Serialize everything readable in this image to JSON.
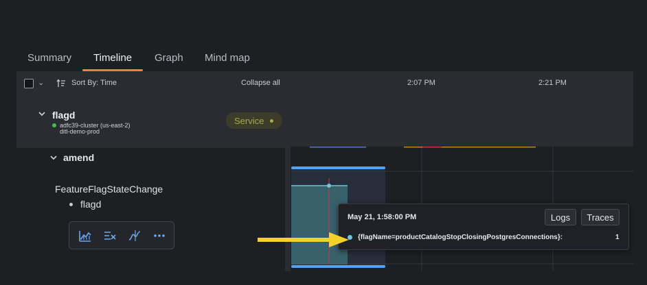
{
  "tabs": [
    {
      "label": "Summary",
      "active": false
    },
    {
      "label": "Timeline",
      "active": true
    },
    {
      "label": "Graph",
      "active": false
    },
    {
      "label": "Mind map",
      "active": false
    }
  ],
  "header": {
    "sort_label": "Sort By: Time",
    "collapse_label": "Collapse all",
    "time_ticks": [
      "2:07 PM",
      "2:21 PM"
    ]
  },
  "service": {
    "name": "flagd",
    "cluster": "adfc39-cluster (us-east-2)",
    "environment": "ditl-demo-prod",
    "badge": "Service",
    "status_color": "#3fbf4f"
  },
  "group": {
    "label": "amend"
  },
  "event": {
    "title": "FeatureFlagStateChange",
    "source": "flagd"
  },
  "toolbar": {
    "icons": [
      "chart-line-icon",
      "filter-exclude-icon",
      "anomaly-curve-icon",
      "more-icon"
    ]
  },
  "tooltip": {
    "date": "May 21, 1:58:00 PM",
    "logs_label": "Logs",
    "traces_label": "Traces",
    "series_label": "{flagName=productCatalogStopClosingPostgresConnections}:",
    "series_value": "1"
  },
  "colors": {
    "accent": "#ff7a45",
    "series": "#6ec6d6",
    "highlight_bar": "#5aa0f0",
    "marker": "#c9353b",
    "arrow": "#f5d02b"
  }
}
